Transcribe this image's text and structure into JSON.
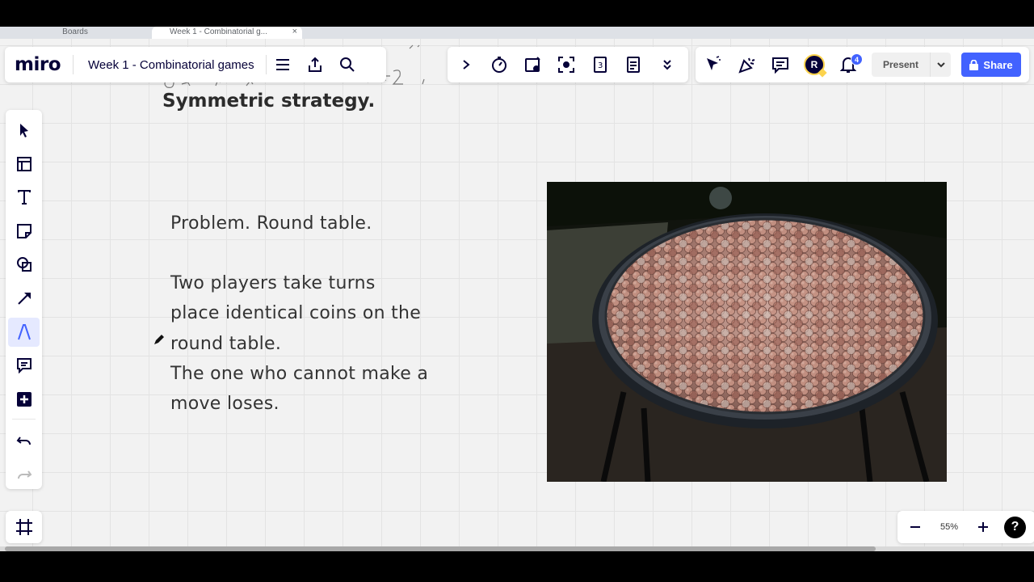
{
  "browser": {
    "tabs": [
      {
        "label": "Boards",
        "active": false
      },
      {
        "label": "Week 1 - Combinatorial g...",
        "active": true
      }
    ],
    "close_glyph": "×"
  },
  "app": {
    "logo": "miro",
    "board_title": "Week 1 - Combinatorial games",
    "title_tools": [
      "menu-icon",
      "export-icon",
      "search-icon"
    ],
    "collab_tools": [
      "expand-icon",
      "timer-icon",
      "voting-icon",
      "attention-icon",
      "cards-icon",
      "notes-icon",
      "more-icon"
    ],
    "right_tools": [
      "cursor-icon",
      "reaction-icon",
      "comments-icon"
    ],
    "avatar_initial": "R",
    "notification_count": "4",
    "present_label": "Present",
    "share_label": "Share",
    "accent_color": "#4262ff"
  },
  "left_toolbar": {
    "tools": [
      "select-tool",
      "templates-tool",
      "text-tool",
      "sticky-note-tool",
      "shapes-tool",
      "connection-line-tool",
      "pen-tool",
      "comment-tool",
      "more-apps-tool",
      "undo",
      "redo"
    ],
    "active_tool": "pen-tool"
  },
  "board": {
    "heading": "Symmetric strategy.",
    "problem_title": "Problem. Round table.",
    "problem_lines": [
      "Two players take turns",
      "place identical coins on the",
      "round table.",
      "The one who cannot make a",
      "move loses."
    ]
  },
  "zoom": {
    "level": "55%",
    "help": "?"
  }
}
